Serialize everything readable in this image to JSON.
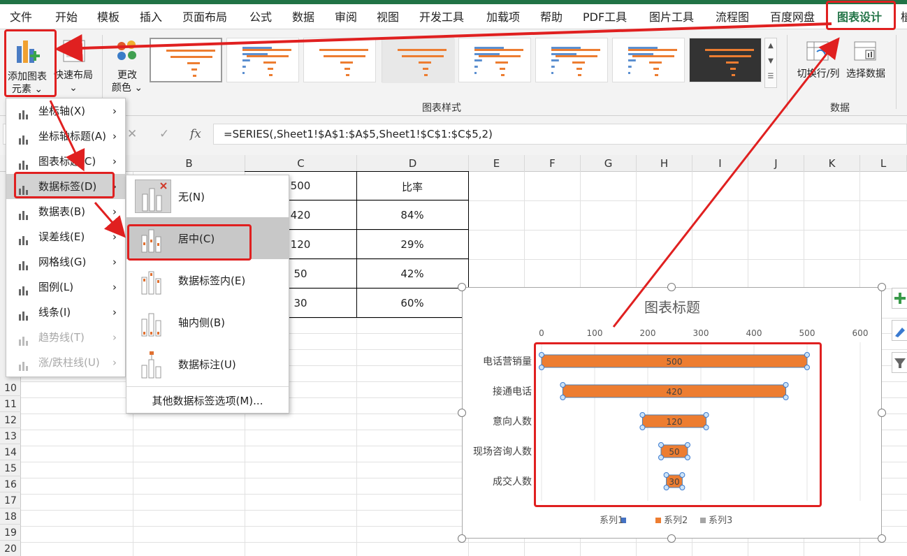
{
  "menu_tabs": [
    "文件",
    "开始",
    "模板",
    "插入",
    "页面布局",
    "公式",
    "数据",
    "审阅",
    "视图",
    "开发工具",
    "加载项",
    "帮助",
    "PDF工具",
    "图片工具",
    "流程图",
    "百度网盘",
    "图表设计",
    "植"
  ],
  "active_tab": "图表设计",
  "ribbon": {
    "add_chart_element": [
      "添加图表",
      "元素 ⌄"
    ],
    "quick_layout": [
      "快速布局",
      "⌄"
    ],
    "change_colors": [
      "更改",
      "颜色 ⌄"
    ],
    "styles_group": "图表样式",
    "switch_row_col": "切换行/列",
    "select_data": "选择数据",
    "data_group": "数据"
  },
  "formula_bar": {
    "fx": "fx",
    "cancel": "✕",
    "confirm": "✓",
    "formula": "=SERIES(,Sheet1!$A$1:$A$5,Sheet1!$C$1:$C$5,2)"
  },
  "columns": [
    "B",
    "C",
    "D",
    "E",
    "F",
    "G",
    "H",
    "I",
    "J",
    "K",
    "L"
  ],
  "rows": [
    "10",
    "11",
    "12",
    "13",
    "14",
    "15",
    "16",
    "17",
    "18",
    "19",
    "20"
  ],
  "table": {
    "c_values": [
      "500",
      "420",
      "120",
      "50",
      "30"
    ],
    "d_header": "比率",
    "d_values": [
      "84%",
      "29%",
      "42%",
      "60%"
    ]
  },
  "menu1_items": [
    {
      "label": "坐标轴(X)",
      "enabled": true
    },
    {
      "label": "坐标轴标题(A)",
      "enabled": true
    },
    {
      "label": "图表标题(C)",
      "enabled": true
    },
    {
      "label": "数据标签(D)",
      "enabled": true
    },
    {
      "label": "数据表(B)",
      "enabled": true
    },
    {
      "label": "误差线(E)",
      "enabled": true
    },
    {
      "label": "网格线(G)",
      "enabled": true
    },
    {
      "label": "图例(L)",
      "enabled": true
    },
    {
      "label": "线条(I)",
      "enabled": true
    },
    {
      "label": "趋势线(T)",
      "enabled": false
    },
    {
      "label": "涨/跌柱线(U)",
      "enabled": false
    }
  ],
  "menu2_items": [
    "无(N)",
    "居中(C)",
    "数据标签内(E)",
    "轴内侧(B)",
    "数据标注(U)"
  ],
  "menu2_more": "其他数据标签选项(M)...",
  "chart_data": {
    "type": "bar",
    "title": "图表标题",
    "categories": [
      "电话营销量",
      "接通电话",
      "意向人数",
      "现场咨询人数",
      "成交人数"
    ],
    "series": [
      {
        "name": "系列2",
        "start": [
          0,
          40,
          190,
          225,
          235
        ],
        "values": [
          500,
          420,
          120,
          50,
          30
        ]
      }
    ],
    "data_labels": [
      "500",
      "420",
      "120",
      "50",
      "30"
    ],
    "xlim": [
      0,
      600
    ],
    "x_ticks": [
      "0",
      "100",
      "200",
      "300",
      "400",
      "500",
      "600"
    ],
    "legend": [
      "系列1",
      "系列2",
      "系列3"
    ],
    "legend_position": "bottom",
    "grid": true,
    "bar_color": "#ED7D31",
    "legend_colors": [
      "#4472C4",
      "#ED7D31",
      "#A5A5A5"
    ]
  },
  "side_buttons": [
    "plus-icon",
    "brush-icon",
    "filter-icon"
  ]
}
